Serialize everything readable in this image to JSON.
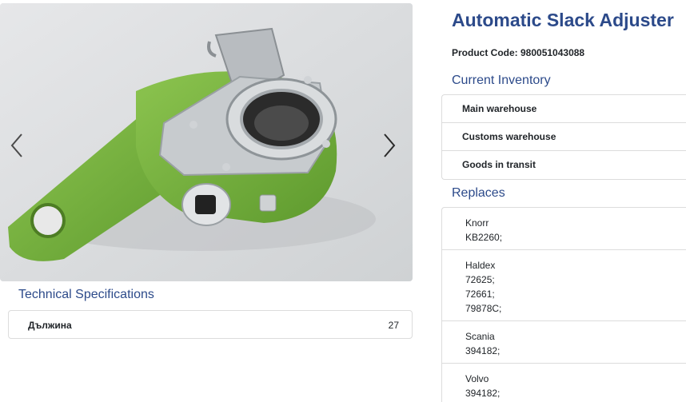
{
  "product": {
    "title": "Automatic Slack Adjuster",
    "code_text": "Product Code: 980051043088"
  },
  "gallery": {
    "image_icon": "slack-adjuster-photo",
    "prev_icon": "chevron-left-icon",
    "next_icon": "chevron-right-icon"
  },
  "specs": {
    "title": "Technical Specifications",
    "rows": [
      {
        "name": "Дължина",
        "value": "27"
      }
    ]
  },
  "inventory": {
    "title": "Current Inventory",
    "items": [
      {
        "label": "Main warehouse"
      },
      {
        "label": "Customs warehouse"
      },
      {
        "label": "Goods in transit"
      }
    ]
  },
  "replaces": {
    "title": "Replaces",
    "groups": [
      {
        "brand": "Knorr",
        "codes": [
          "KB2260;"
        ]
      },
      {
        "brand": "Haldex",
        "codes": [
          "72625;",
          "72661;",
          "79878C;"
        ]
      },
      {
        "brand": "Scania",
        "codes": [
          "394182;"
        ]
      },
      {
        "brand": "Volvo",
        "codes": [
          "394182;"
        ]
      }
    ]
  },
  "colors": {
    "heading": "#2c4a8a",
    "part_green": "#7cb342",
    "border": "#dcdcdc"
  }
}
